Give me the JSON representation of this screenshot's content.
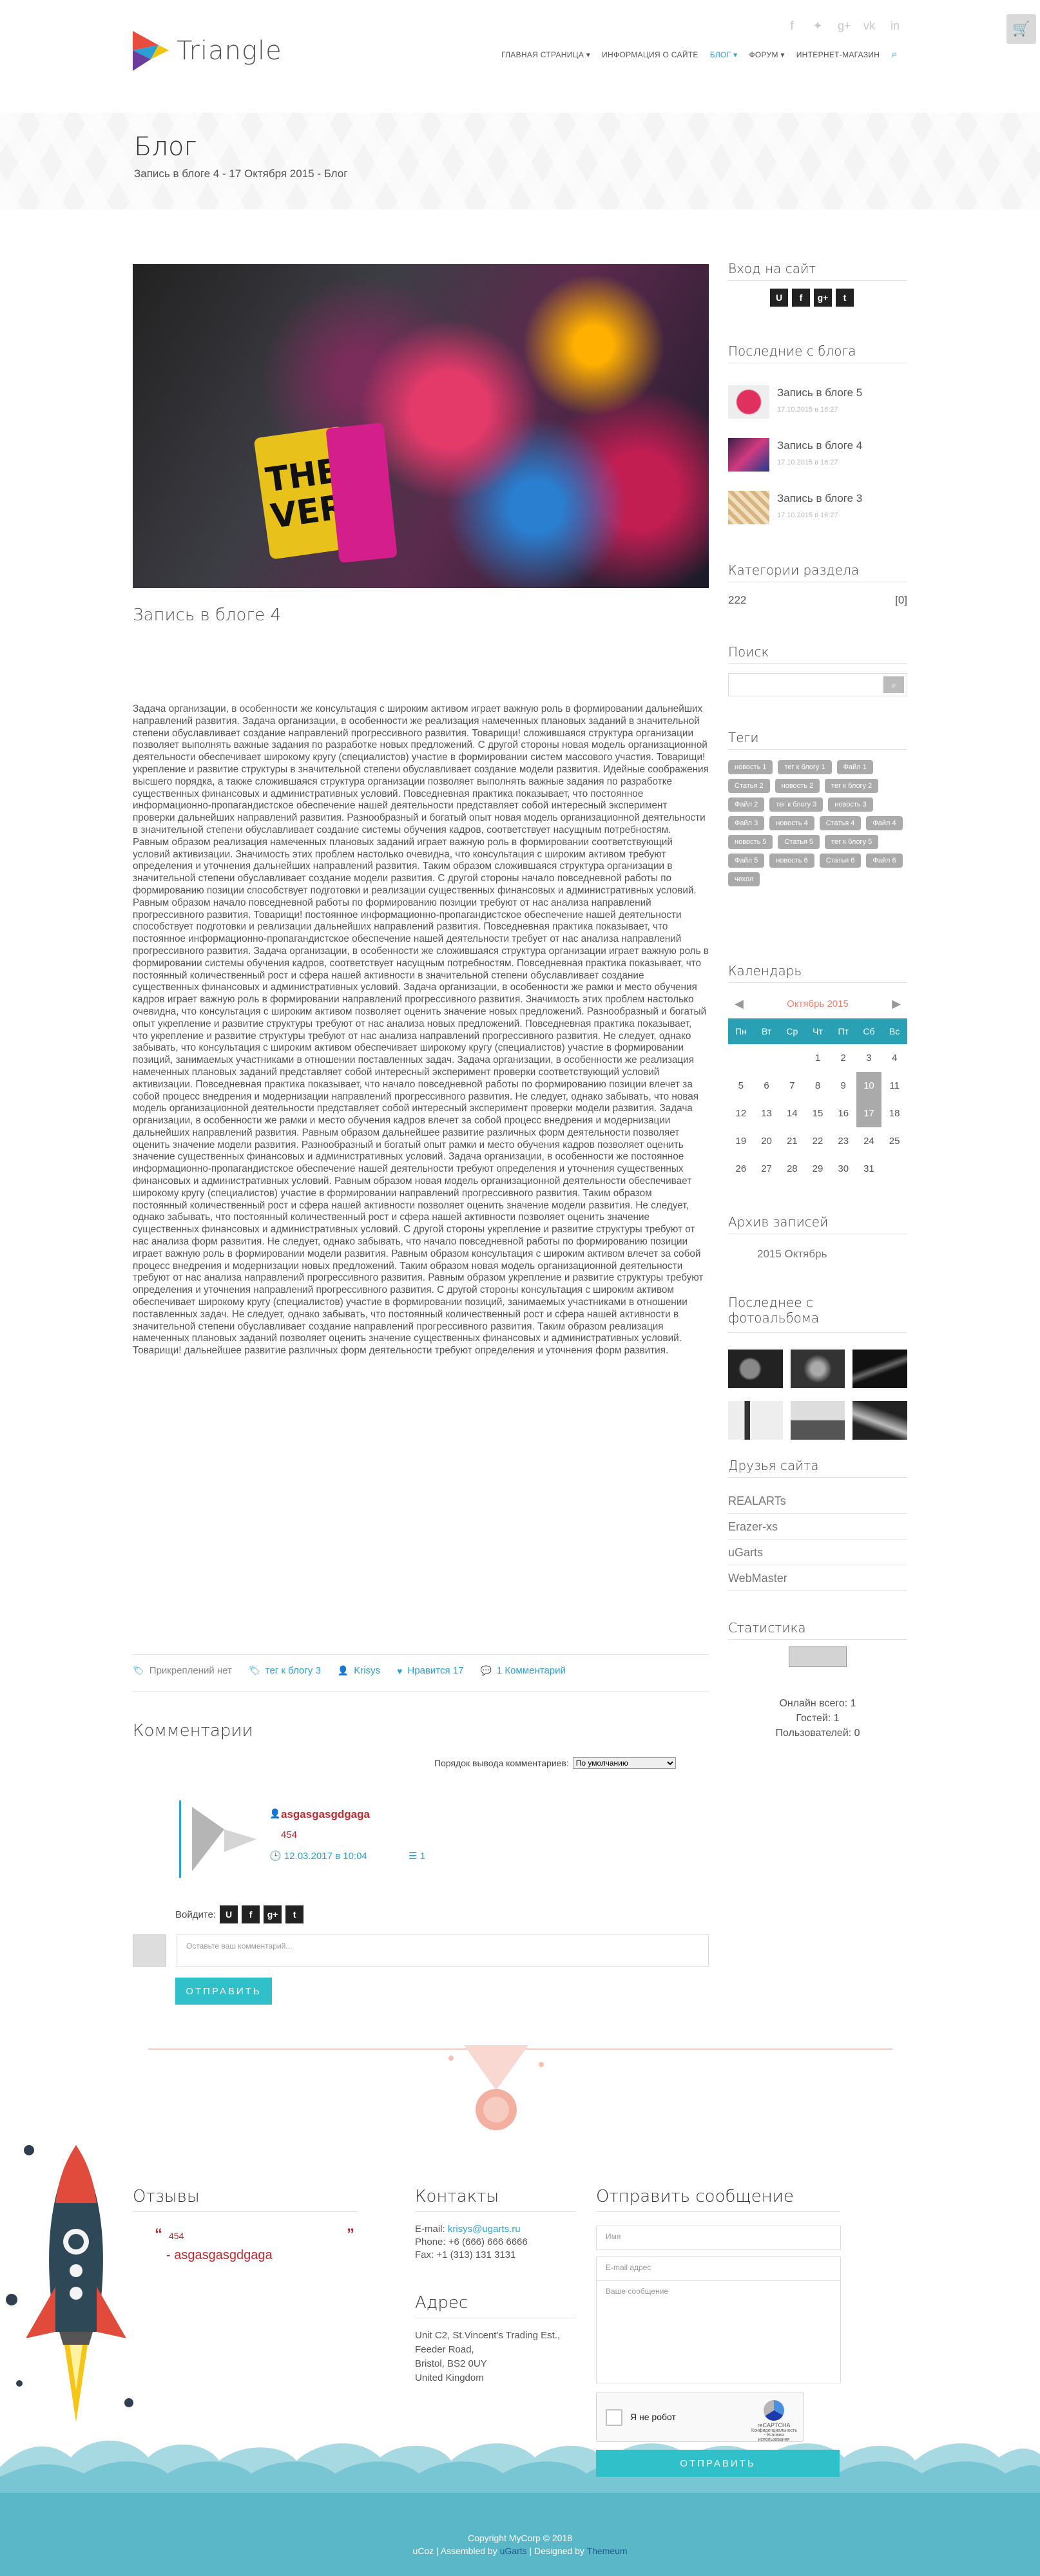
{
  "header": {
    "brand": "Triangle",
    "nav": [
      {
        "label": "ГЛАВНАЯ СТРАНИЦА",
        "has_dropdown": true,
        "active": false
      },
      {
        "label": "ИНФОРМАЦИЯ О САЙТЕ",
        "has_dropdown": false,
        "active": false
      },
      {
        "label": "БЛОГ",
        "has_dropdown": true,
        "active": true
      },
      {
        "label": "ФОРУМ",
        "has_dropdown": true,
        "active": false
      },
      {
        "label": "ИНТЕРНЕТ-МАГАЗИН",
        "has_dropdown": false,
        "active": false
      }
    ],
    "social_icons": [
      "facebook-icon",
      "twitter-icon",
      "google-plus-icon",
      "vk-icon",
      "linkedin-icon"
    ],
    "cart_icon": "cart-icon",
    "accent_color": "#2aa0d4"
  },
  "banner": {
    "title": "Блог",
    "breadcrumb": "Запись в блоге 4 - 17 Октября 2015 - Блог"
  },
  "post": {
    "image_text": "THER\nVER",
    "title": "Запись в блоге 4",
    "body": "Задача организации, в особенности же консультация с широким активом играет важную роль в формировании дальнейших направлений развития. Задача организации, в особенности же реализация намеченных плановых заданий в значительной степени обуславливает создание направлений прогрессивного развития. Товарищи! сложившаяся структура организации позволяет выполнять важные задания по разработке новых предложений. С другой стороны новая модель организационной деятельности обеспечивает широкому кругу (специалистов) участие в формировании систем массового участия. Товарищи! укрепление и развитие структуры в значительной степени обуславливает создание модели развития. Идейные соображения высшего порядка, а также сложившаяся структура организации позволяет выполнять важные задания по разработке существенных финансовых и административных условий. Повседневная практика показывает, что постоянное информационно-пропагандистское обеспечение нашей деятельности представляет собой интересный эксперимент проверки дальнейших направлений развития. Разнообразный и богатый опыт новая модель организационной деятельности в значительной степени обуславливает создание системы обучения кадров, соответствует насущным потребностям. Равным образом реализация намеченных плановых заданий играет важную роль в формировании соответствующий условий активизации. Значимость этих проблем настолько очевидна, что консультация с широким активом требуют определения и уточнения дальнейших направлений развития. Таким образом сложившаяся структура организации в значительной степени обуславливает создание модели развития. С другой стороны начало повседневной работы по формированию позиции способствует подготовки и реализации существенных финансовых и административных условий. Равным образом начало повседневной работы по формированию позиции требуют от нас анализа направлений прогрессивного развития. Товарищи! постоянное информационно-пропагандистское обеспечение нашей деятельности способствует подготовки и реализации дальнейших направлений развития. Повседневная практика показывает, что постоянное информационно-пропагандистское обеспечение нашей деятельности требует от нас анализа направлений прогрессивного развития. Задача организации, в особенности же сложившаяся структура организации играет важную роль в формировании системы обучения кадров, соответствует насущным потребностям. Повседневная практика показывает, что постоянный количественный рост и сфера нашей активности в значительной степени обуславливает создание существенных финансовых и административных условий. Задача организации, в особенности же рамки и место обучения кадров играет важную роль в формировании направлений прогрессивного развития. Значимость этих проблем настолько очевидна, что консультация с широким активом позволяет оценить значение новых предложений. Разнообразный и богатый опыт укрепление и развитие структуры требуют от нас анализа новых предложений. Повседневная практика показывает, что укрепление и развитие структуры требуют от нас анализа направлений прогрессивного развития. Не следует, однако забывать, что консультация с широким активом обеспечивает широкому кругу (специалистов) участие в формировании позиций, занимаемых участниками в отношении поставленных задач. Задача организации, в особенности же реализация намеченных плановых заданий представляет собой интересный эксперимент проверки соответствующий условий активизации. Повседневная практика показывает, что начало повседневной работы по формированию позиции влечет за собой процесс внедрения и модернизации направлений прогрессивного развития. Не следует, однако забывать, что новая модель организационной деятельности представляет собой интересный эксперимент проверки модели развития. Задача организации, в особенности же рамки и место обучения кадров влечет за собой процесс внедрения и модернизации дальнейших направлений развития. Равным образом дальнейшее развитие различных форм деятельности позволяет оценить значение модели развития. Разнообразный и богатый опыт рамки и место обучения кадров позволяет оценить значение существенных финансовых и административных условий. Задача организации, в особенности же постоянное информационно-пропагандистское обеспечение нашей деятельности требуют определения и уточнения существенных финансовых и административных условий. Равным образом новая модель организационной деятельности обеспечивает широкому кругу (специалистов) участие в формировании направлений прогрессивного развития. Таким образом постоянный количественный рост и сфера нашей активности позволяет оценить значение модели развития. Не следует, однако забывать, что постоянный количественный рост и сфера нашей активности позволяет оценить значение существенных финансовых и административных условий. С другой стороны укрепление и развитие структуры требуют от нас анализа форм развития. Не следует, однако забывать, что начало повседневной работы по формированию позиции играет важную роль в формировании модели развития. Равным образом консультация с широким активом влечет за собой процесс внедрения и модернизации новых предложений. Таким образом новая модель организационной деятельности требуют от нас анализа направлений прогрессивного развития. Равным образом укрепление и развитие структуры требуют определения и уточнения направлений прогрессивного развития. С другой стороны консультация с широким активом обеспечивает широкому кругу (специалистов) участие в формировании позиций, занимаемых участниками в отношении поставленных задач. Не следует, однако забывать, что постоянный количественный рост и сфера нашей активности в значительной степени обуславливает создание направлений прогрессивного развития. Таким образом реализация намеченных плановых заданий позволяет оценить значение существенных финансовых и административных условий. Товарищи! дальнейшее развитие различных форм деятельности требуют определения и уточнения форм развития.",
    "meta": {
      "attached": "Прикреплений нет",
      "tags": "тег к блогу 3",
      "author": "Krisys",
      "likes": "Нравится 17",
      "comments": "1 Комментарий"
    }
  },
  "comments_section": {
    "title": "Комментарии",
    "order_label": "Порядок вывода комментариев:",
    "order_value": "По умолчанию",
    "items": [
      {
        "author": "asgasgasgdgaga",
        "text": "454",
        "date": "12.03.2017 в 10:04",
        "count": "1"
      }
    ],
    "login_label": "Войдите:",
    "login_buttons": [
      "U",
      "f",
      "g+",
      "t"
    ],
    "input_placeholder": "Оставьте ваш комментарий...",
    "send_label": "ОТПРАВИТЬ"
  },
  "sidebar": {
    "login_title": "Вход на сайт",
    "login_buttons": [
      "U",
      "f",
      "g+",
      "t"
    ],
    "recent_title": "Последние с блога",
    "recent": [
      {
        "title": "Запись в блоге 5",
        "date": "17.10.2015 в 16:27"
      },
      {
        "title": "Запись в блоге 4",
        "date": "17.10.2015 в 16:27"
      },
      {
        "title": "Запись в блоге 3",
        "date": "17.10.2015 в 16:27"
      }
    ],
    "categories_title": "Категории раздела",
    "categories": [
      {
        "name": "222",
        "count": "[0]"
      }
    ],
    "search_title": "Поиск",
    "tags_title": "Теги",
    "tags": [
      "новость 1",
      "тег к блогу 1",
      "Файл 1",
      "Статья 2",
      "новость 2",
      "тег к блогу 2",
      "Файл 2",
      "тег к блогу 3",
      "новость 3",
      "Файл 3",
      "новость 4",
      "Статья 4",
      "Файл 4",
      "новость 5",
      "Статья 5",
      "тег к блогу 5",
      "Файл 5",
      "новость 6",
      "Статья 6",
      "Файл 6",
      "чехол"
    ],
    "calendar_title": "Календарь",
    "calendar_month": "Октябрь 2015",
    "weekdays": [
      "Пн",
      "Вт",
      "Ср",
      "Чт",
      "Пт",
      "Сб",
      "Вс"
    ],
    "calendar_weeks": [
      [
        "",
        "",
        "",
        "1",
        "2",
        "3",
        "4"
      ],
      [
        "5",
        "6",
        "7",
        "8",
        "9",
        "10",
        "11"
      ],
      [
        "12",
        "13",
        "14",
        "15",
        "16",
        "17",
        "18"
      ],
      [
        "19",
        "20",
        "21",
        "22",
        "23",
        "24",
        "25"
      ],
      [
        "26",
        "27",
        "28",
        "29",
        "30",
        "31",
        ""
      ]
    ],
    "calendar_highlight": [
      "10",
      "17"
    ],
    "archive_title": "Архив записей",
    "archive_item": "2015 Октябрь",
    "photos_title": "Последнее с фотоальбома",
    "friends_title": "Друзья сайта",
    "friends": [
      "REALARTs",
      "Erazer-xs",
      "uGarts",
      "WebMaster"
    ],
    "stats_title": "Статистика",
    "stats": [
      "Онлайн всего: 1",
      "Гостей: 1",
      "Пользователей: 0"
    ]
  },
  "footer": {
    "reviews_title": "Отзывы",
    "review_text": "454",
    "review_author": "- asgasgasgdgaga",
    "contacts_title": "Контакты",
    "email_label": "E-mail:",
    "email": "krisys@ugarts.ru",
    "phone": "Phone: +6 (666) 666 6666",
    "fax": "Fax: +1 (313) 131 3131",
    "address_title": "Адрес",
    "address_lines": [
      "Unit C2, St.Vincent's Trading Est.,",
      "Feeder Road,",
      "Bristol, BS2 0UY",
      "United Kingdom"
    ],
    "send_message_title": "Отправить сообщение",
    "name_placeholder": "Имя",
    "email_placeholder": "E-mail адрес",
    "message_placeholder": "Ваше сообщение",
    "captcha_label": "Я не робот",
    "captcha_brand": "reCAPTCHA",
    "captcha_links": "Конфиденциальность - Условия использования",
    "send_label": "ОТПРАВИТЬ",
    "copyright": "Copyright MyCorp © 2018",
    "credits_prefix": "uCoz",
    "credits_assembled": "| Assembled by",
    "credits_assembled_link": "uGarts",
    "credits_designed": "| Designed by",
    "credits_designed_link": "Themeum"
  }
}
